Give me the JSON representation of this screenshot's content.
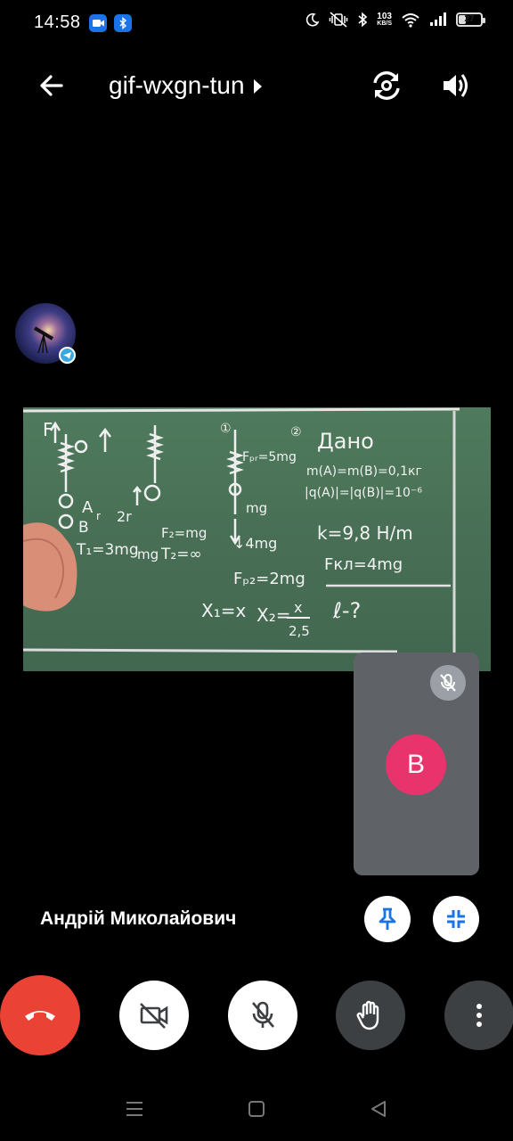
{
  "status_bar": {
    "time": "14:58",
    "network_speed_value": "103",
    "network_speed_unit": "KB/S",
    "battery_level": "27",
    "icons": [
      "meet-app-icon",
      "bluetooth-app-icon",
      "moon-icon",
      "vibrate-icon",
      "bluetooth-icon",
      "wifi-icon",
      "signal-icon",
      "battery-icon"
    ]
  },
  "header": {
    "meeting_code": "gif-wxgn-tun",
    "icons": [
      "back-arrow-icon",
      "chevron-right-icon",
      "switch-camera-icon",
      "speaker-icon"
    ]
  },
  "main_tile": {
    "participant_name": "Андрій Миколайович",
    "icons": [
      "pin-icon",
      "minimize-icon",
      "telegram-badge-icon"
    ]
  },
  "self_view": {
    "avatar_letter": "B",
    "icons": [
      "mic-off-icon"
    ]
  },
  "controls": {
    "icons": [
      "end-call-icon",
      "camera-off-icon",
      "mic-off-icon",
      "raise-hand-icon",
      "more-options-icon"
    ],
    "colors": {
      "end_call": "#ea4335",
      "button_light": "#ffffff",
      "button_dark": "#3c4043"
    }
  },
  "nav_bar": {
    "icons": [
      "recents-icon",
      "home-icon",
      "back-icon"
    ]
  },
  "colors": {
    "self_avatar": "#e8336d",
    "self_tile": "#5f6368",
    "board": "#4a7357"
  }
}
